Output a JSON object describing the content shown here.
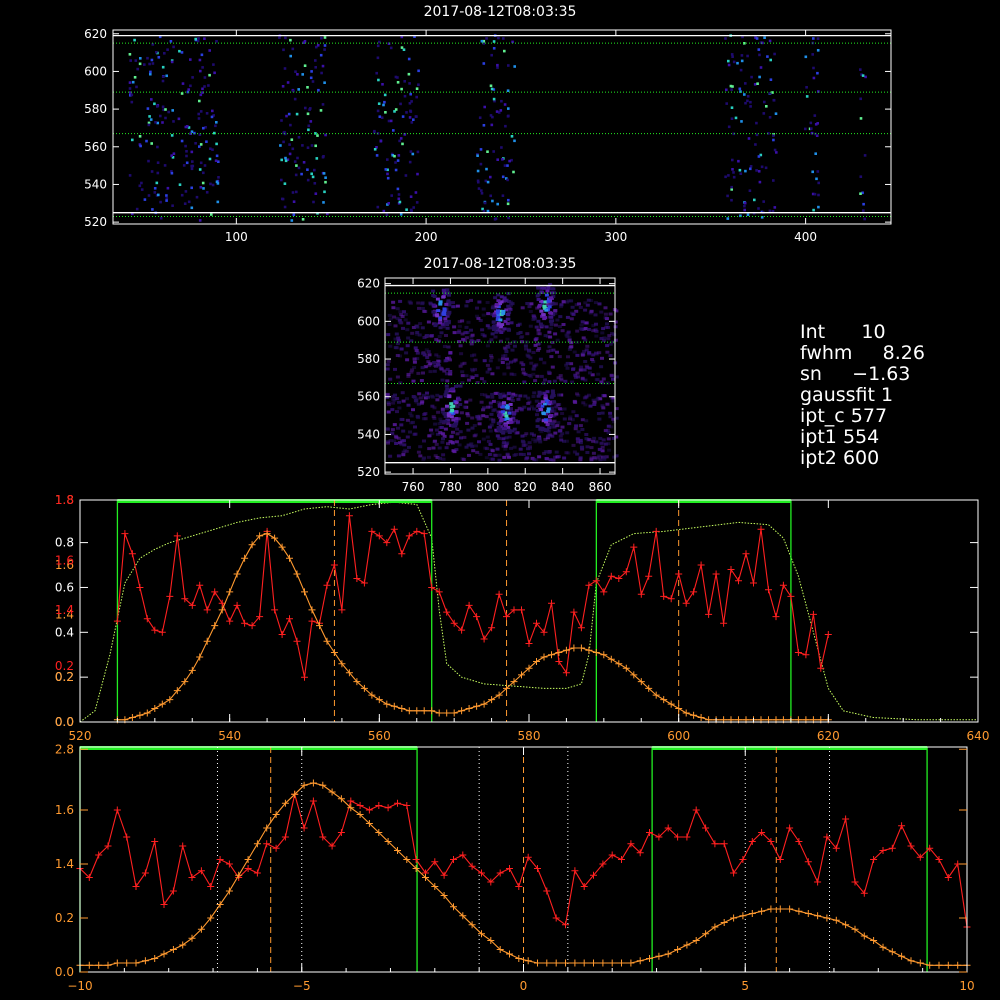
{
  "chart_data": [
    {
      "id": "top-image",
      "type": "heatmap",
      "title": "2017-08-12T08:03:35",
      "xlim": [
        35,
        445
      ],
      "ylim": [
        519,
        622
      ],
      "x_ticks": [
        "100",
        "200",
        "300",
        "400"
      ],
      "y_ticks": [
        "520",
        "540",
        "560",
        "580",
        "600",
        "620"
      ],
      "bands": [
        [
          43,
          90
        ],
        [
          122,
          148
        ],
        [
          172,
          196
        ],
        [
          226,
          246
        ],
        [
          357,
          384
        ],
        [
          399,
          407
        ],
        [
          428,
          431
        ]
      ],
      "hlines_dotted": [
        615,
        589,
        567,
        523
      ],
      "hlines_solid_white": [
        619,
        525
      ],
      "colormap": [
        "#1e0a6e",
        "#3a10a8",
        "#2a3fe0",
        "#1f8fe8",
        "#28d0c0",
        "#60f090"
      ]
    },
    {
      "id": "zoom-image",
      "type": "heatmap",
      "title": "2017-08-12T08:03:35",
      "xlim": [
        745,
        868
      ],
      "ylim": [
        519,
        623
      ],
      "x_ticks": [
        "760",
        "780",
        "800",
        "820",
        "840",
        "860"
      ],
      "y_ticks": [
        "520",
        "540",
        "560",
        "580",
        "600",
        "620"
      ],
      "hlines_dotted": [
        615,
        589,
        567
      ],
      "hlines_solid_white": [
        619,
        525
      ],
      "hotspots": [
        [
          775,
          607
        ],
        [
          807,
          604
        ],
        [
          831,
          609
        ],
        [
          781,
          555
        ],
        [
          810,
          552
        ],
        [
          831,
          553
        ]
      ]
    },
    {
      "id": "profile-panel",
      "type": "line",
      "xlim": [
        520,
        640
      ],
      "ylim": [
        0,
        0.99
      ],
      "x_ticks": [
        "520",
        "540",
        "560",
        "580",
        "600",
        "620",
        "640"
      ],
      "y_ticks_white": [
        "0.0",
        "0.2",
        "0.4",
        "0.6",
        "0.8"
      ],
      "y_ticks_orange": [
        "0.0",
        "0.2",
        "1.4",
        "1.6",
        "1.8"
      ],
      "y_ticks_red": [
        "0.2",
        "1.4",
        "1.6",
        "1.8"
      ],
      "green_box_1": [
        525,
        567
      ],
      "green_box_2": [
        589,
        615
      ],
      "dashed_lines": [
        554,
        577,
        600
      ],
      "gauss": {
        "type": "gaussian-pair",
        "a1": 0.835,
        "c1": 554,
        "s1": 4.5,
        "a2": 0.335,
        "c2": 600,
        "s2": 6.5,
        "base": 0.02,
        "x0": 525,
        "x1": 620,
        "n": 96
      },
      "ratio_y": [
        0.45,
        0.84,
        0.75,
        0.6,
        0.46,
        0.41,
        0.4,
        0.56,
        0.83,
        0.55,
        0.52,
        0.61,
        0.5,
        0.58,
        0.53,
        0.45,
        0.52,
        0.44,
        0.43,
        0.47,
        0.85,
        0.5,
        0.39,
        0.46,
        0.36,
        0.2,
        0.45,
        0.44,
        0.61,
        0.7,
        0.5,
        0.92,
        0.64,
        0.62,
        0.85,
        0.83,
        0.8,
        0.86,
        0.75,
        0.83,
        0.85,
        0.84,
        0.6,
        0.58,
        0.49,
        0.44,
        0.41,
        0.52,
        0.47,
        0.37,
        0.42,
        0.57,
        0.47,
        0.5,
        0.5,
        0.35,
        0.44,
        0.4,
        0.53,
        0.27,
        0.22,
        0.49,
        0.42,
        0.61,
        0.63,
        0.58,
        0.65,
        0.64,
        0.67,
        0.78,
        0.57,
        0.65,
        0.85,
        0.56,
        0.55,
        0.66,
        0.53,
        0.58,
        0.7,
        0.48,
        0.66,
        0.44,
        0.68,
        0.63,
        0.75,
        0.62,
        0.86,
        0.59,
        0.47,
        0.61,
        0.56,
        0.31,
        0.3,
        0.48,
        0.24,
        0.39
      ],
      "gauss_y": [
        0.01,
        0.01,
        0.02,
        0.03,
        0.04,
        0.06,
        0.08,
        0.1,
        0.14,
        0.18,
        0.23,
        0.29,
        0.36,
        0.43,
        0.5,
        0.58,
        0.66,
        0.73,
        0.79,
        0.83,
        0.84,
        0.82,
        0.78,
        0.73,
        0.66,
        0.58,
        0.5,
        0.43,
        0.36,
        0.31,
        0.26,
        0.22,
        0.18,
        0.15,
        0.12,
        0.1,
        0.08,
        0.07,
        0.06,
        0.05,
        0.05,
        0.05,
        0.05,
        0.04,
        0.04,
        0.04,
        0.05,
        0.06,
        0.07,
        0.08,
        0.1,
        0.12,
        0.15,
        0.18,
        0.21,
        0.24,
        0.27,
        0.29,
        0.3,
        0.31,
        0.32,
        0.33,
        0.33,
        0.32,
        0.31,
        0.3,
        0.28,
        0.26,
        0.24,
        0.21,
        0.18,
        0.15,
        0.12,
        0.1,
        0.08,
        0.06,
        0.04,
        0.03,
        0.02,
        0.01,
        0.01,
        0.01,
        0.01,
        0.01,
        0.01,
        0.01,
        0.01,
        0.01,
        0.01,
        0.01,
        0.01,
        0.01,
        0.01,
        0.01,
        0.01,
        0.01
      ]
    },
    {
      "id": "velocity-panel",
      "type": "line",
      "xlim": [
        -10,
        10
      ],
      "ylim": [
        0,
        2.8
      ],
      "x_ticks": [
        "−10",
        "−5",
        "0",
        "5",
        "10"
      ],
      "y_ticks": [
        "0.0",
        "0.2",
        "1.4",
        "1.6",
        "2.8"
      ],
      "green_box_1": [
        -10,
        -2.4
      ],
      "green_box_2": [
        2.9,
        9.1
      ],
      "dashed_lines": [
        -5.7,
        0,
        5.7
      ],
      "dotted_lines": [
        -6.9,
        -5,
        -1,
        1,
        5,
        6.9
      ],
      "gauss": {
        "type": "gaussian-pair",
        "a1": 0.84,
        "c1": -5.6,
        "s1": 1.5,
        "a2": 0.28,
        "c2": 5.6,
        "s2": 1.9,
        "base": 0.03,
        "x0": -10,
        "x1": 10,
        "n": 96
      },
      "ratio_y": [
        0.46,
        0.42,
        0.52,
        0.56,
        0.72,
        0.6,
        0.38,
        0.44,
        0.58,
        0.3,
        0.36,
        0.56,
        0.42,
        0.45,
        0.38,
        0.5,
        0.48,
        0.42,
        0.46,
        0.44,
        0.57,
        0.55,
        0.6,
        0.79,
        0.64,
        0.76,
        0.6,
        0.56,
        0.62,
        0.76,
        0.74,
        0.72,
        0.74,
        0.73,
        0.75,
        0.74,
        0.5,
        0.44,
        0.49,
        0.43,
        0.5,
        0.52,
        0.47,
        0.44,
        0.4,
        0.44,
        0.46,
        0.38,
        0.51,
        0.46,
        0.36,
        0.24,
        0.21,
        0.45,
        0.38,
        0.43,
        0.48,
        0.52,
        0.5,
        0.57,
        0.53,
        0.62,
        0.6,
        0.64,
        0.6,
        0.6,
        0.72,
        0.64,
        0.57,
        0.57,
        0.44,
        0.5,
        0.58,
        0.62,
        0.58,
        0.5,
        0.64,
        0.58,
        0.49,
        0.4,
        0.6,
        0.55,
        0.68,
        0.4,
        0.35,
        0.5,
        0.54,
        0.55,
        0.65,
        0.56,
        0.51,
        0.55,
        0.5,
        0.42,
        0.48,
        0.2
      ],
      "gauss_y": [
        0.03,
        0.03,
        0.03,
        0.03,
        0.04,
        0.04,
        0.04,
        0.05,
        0.06,
        0.08,
        0.1,
        0.12,
        0.15,
        0.19,
        0.24,
        0.3,
        0.36,
        0.43,
        0.5,
        0.57,
        0.64,
        0.7,
        0.75,
        0.79,
        0.83,
        0.84,
        0.83,
        0.8,
        0.77,
        0.73,
        0.7,
        0.66,
        0.62,
        0.58,
        0.54,
        0.5,
        0.46,
        0.42,
        0.38,
        0.34,
        0.29,
        0.25,
        0.21,
        0.17,
        0.14,
        0.1,
        0.08,
        0.06,
        0.05,
        0.04,
        0.04,
        0.04,
        0.04,
        0.04,
        0.04,
        0.04,
        0.04,
        0.04,
        0.04,
        0.04,
        0.05,
        0.06,
        0.07,
        0.08,
        0.1,
        0.12,
        0.14,
        0.17,
        0.2,
        0.22,
        0.24,
        0.25,
        0.26,
        0.27,
        0.28,
        0.28,
        0.28,
        0.27,
        0.26,
        0.25,
        0.24,
        0.23,
        0.21,
        0.19,
        0.16,
        0.14,
        0.11,
        0.09,
        0.07,
        0.05,
        0.04,
        0.03,
        0.03,
        0.03,
        0.03,
        0.03
      ]
    }
  ],
  "info_panel": {
    "int_label": "Int",
    "int_value": "10",
    "fwhm_label": "fwhm",
    "fwhm_value": "8.26",
    "sn_label": "sn",
    "sn_value": "−1.63",
    "gaussfit_label": "gaussfit",
    "gaussfit_value": "1",
    "ipt_c_label": "ipt_c",
    "ipt_c_value": "577",
    "ipt1_label": "ipt1",
    "ipt1_value": "554",
    "ipt2_label": "ipt2",
    "ipt2_value": "600"
  }
}
